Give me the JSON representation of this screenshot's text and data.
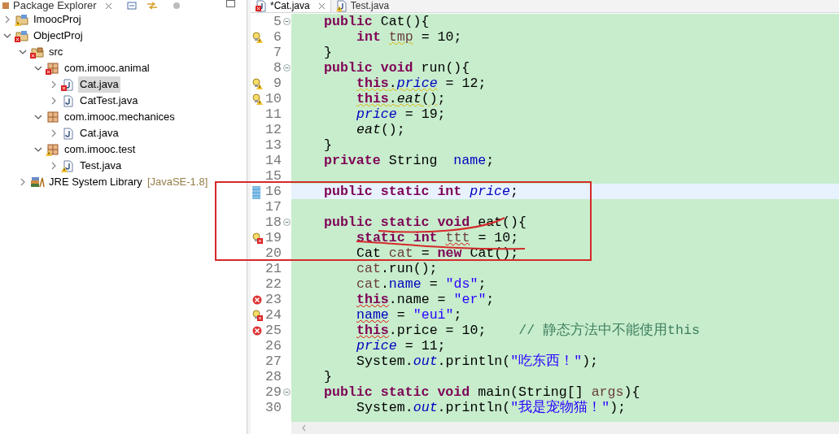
{
  "explorer": {
    "title": "Package Explorer",
    "tree": [
      {
        "label": "ImoocProj",
        "kind": "project",
        "error": false,
        "warning": true,
        "expanded": false,
        "selected": false
      },
      {
        "label": "ObjectProj",
        "kind": "project",
        "error": true,
        "warning": false,
        "expanded": true,
        "selected": false,
        "children": [
          {
            "label": "src",
            "kind": "source-folder",
            "error": true,
            "warning": false,
            "expanded": true,
            "selected": false,
            "children": [
              {
                "label": "com.imooc.animal",
                "kind": "package",
                "error": true,
                "warning": false,
                "expanded": true,
                "selected": false,
                "children": [
                  {
                    "label": "Cat.java",
                    "kind": "java-file",
                    "error": true,
                    "warning": false,
                    "expanded": false,
                    "selected": true
                  },
                  {
                    "label": "CatTest.java",
                    "kind": "java-file",
                    "error": false,
                    "warning": false,
                    "expanded": false,
                    "selected": false
                  }
                ]
              },
              {
                "label": "com.imooc.mechanices",
                "kind": "package",
                "error": false,
                "warning": false,
                "expanded": true,
                "selected": false,
                "children": [
                  {
                    "label": "Cat.java",
                    "kind": "java-file",
                    "error": false,
                    "warning": false,
                    "expanded": false,
                    "selected": false
                  }
                ]
              },
              {
                "label": "com.imooc.test",
                "kind": "package",
                "error": false,
                "warning": true,
                "expanded": true,
                "selected": false,
                "children": [
                  {
                    "label": "Test.java",
                    "kind": "java-file",
                    "error": false,
                    "warning": true,
                    "expanded": false,
                    "selected": false
                  }
                ]
              }
            ]
          },
          {
            "label": "JRE System Library",
            "suffix": "[JavaSE-1.8]",
            "kind": "library",
            "error": false,
            "warning": false,
            "expanded": false,
            "selected": false
          }
        ]
      }
    ]
  },
  "editor": {
    "tabs": [
      {
        "label": "*Cat.java",
        "error": true,
        "warning": false,
        "selected": true
      },
      {
        "label": "Test.java",
        "error": false,
        "warning": true,
        "selected": false
      }
    ],
    "lines": [
      {
        "number": "5",
        "kind": "member",
        "fold": true,
        "quickfix": false,
        "warning": false,
        "error": false,
        "highlighted": false,
        "tokens": [
          {
            "kind": "kw",
            "text": "public"
          },
          {
            "kind": "plain",
            "text": " Cat(){"
          }
        ]
      },
      {
        "number": "6",
        "kind": "statement",
        "fold": false,
        "quickfix": true,
        "warning": true,
        "error": false,
        "highlighted": false,
        "tokens": [
          {
            "kind": "kw",
            "text": "int "
          },
          {
            "kind": "warning-underline",
            "tokens": [
              {
                "kind": "local",
                "text": "tmp"
              }
            ]
          },
          {
            "kind": "plain",
            "text": " = 10;"
          }
        ]
      },
      {
        "number": "7",
        "kind": "member",
        "fold": false,
        "quickfix": false,
        "warning": false,
        "error": false,
        "highlighted": false,
        "tokens": [
          {
            "kind": "plain",
            "text": "}"
          }
        ]
      },
      {
        "number": "8",
        "kind": "member",
        "fold": true,
        "quickfix": false,
        "warning": false,
        "error": false,
        "highlighted": false,
        "tokens": [
          {
            "kind": "kw",
            "text": "public void"
          },
          {
            "kind": "plain",
            "text": " run(){"
          }
        ]
      },
      {
        "number": "9",
        "kind": "statement",
        "fold": false,
        "quickfix": true,
        "warning": true,
        "error": false,
        "highlighted": false,
        "tokens": [
          {
            "kind": "warning-underline",
            "tokens": [
              {
                "kind": "kw",
                "text": "this"
              },
              {
                "kind": "plain",
                "text": "."
              },
              {
                "kind": "static-field",
                "text": "price"
              }
            ]
          },
          {
            "kind": "plain",
            "text": " = 12;"
          }
        ]
      },
      {
        "number": "10",
        "kind": "statement",
        "fold": false,
        "quickfix": true,
        "warning": true,
        "error": false,
        "highlighted": false,
        "tokens": [
          {
            "kind": "warning-underline",
            "tokens": [
              {
                "kind": "kw",
                "text": "this"
              },
              {
                "kind": "plain",
                "text": "."
              },
              {
                "kind": "static-method",
                "text": "eat"
              },
              {
                "kind": "plain",
                "text": "()"
              }
            ]
          },
          {
            "kind": "plain",
            "text": ";"
          }
        ]
      },
      {
        "number": "11",
        "kind": "statement",
        "fold": false,
        "quickfix": false,
        "warning": false,
        "error": false,
        "highlighted": false,
        "tokens": [
          {
            "kind": "static-field",
            "text": "price"
          },
          {
            "kind": "plain",
            "text": " = 19;"
          }
        ]
      },
      {
        "number": "12",
        "kind": "statement",
        "fold": false,
        "quickfix": false,
        "warning": false,
        "error": false,
        "highlighted": false,
        "tokens": [
          {
            "kind": "static-method",
            "text": "eat"
          },
          {
            "kind": "plain",
            "text": "();"
          }
        ]
      },
      {
        "number": "13",
        "kind": "member",
        "fold": false,
        "quickfix": false,
        "warning": false,
        "error": false,
        "highlighted": false,
        "tokens": [
          {
            "kind": "plain",
            "text": "}"
          }
        ]
      },
      {
        "number": "14",
        "kind": "member",
        "fold": false,
        "quickfix": false,
        "warning": false,
        "error": false,
        "highlighted": false,
        "tokens": [
          {
            "kind": "kw",
            "text": "private"
          },
          {
            "kind": "plain",
            "text": " String  "
          },
          {
            "kind": "field",
            "text": "name"
          },
          {
            "kind": "plain",
            "text": ";"
          }
        ]
      },
      {
        "number": "15",
        "kind": "blank",
        "fold": false,
        "quickfix": false,
        "warning": false,
        "error": false,
        "highlighted": false
      },
      {
        "number": "16",
        "kind": "member",
        "fold": false,
        "quickfix": false,
        "warning": false,
        "error": false,
        "highlighted": true,
        "tokens": [
          {
            "kind": "kw",
            "text": "public static int "
          },
          {
            "kind": "static-field",
            "text": "price"
          },
          {
            "kind": "plain",
            "text": ";"
          }
        ]
      },
      {
        "number": "17",
        "kind": "blank",
        "fold": false,
        "quickfix": false,
        "warning": false,
        "error": false,
        "highlighted": false
      },
      {
        "number": "18",
        "kind": "member",
        "fold": true,
        "quickfix": false,
        "warning": false,
        "error": false,
        "highlighted": false,
        "tokens": [
          {
            "kind": "kw",
            "text": "public static void"
          },
          {
            "kind": "plain",
            "text": " eat(){"
          }
        ]
      },
      {
        "number": "19",
        "kind": "statement",
        "fold": false,
        "quickfix": true,
        "warning": false,
        "error": true,
        "highlighted": false,
        "tokens": [
          {
            "kind": "kw",
            "text": "static int "
          },
          {
            "kind": "error-underline",
            "tokens": [
              {
                "kind": "local",
                "text": "ttt"
              }
            ]
          },
          {
            "kind": "plain",
            "text": " = 10;"
          }
        ]
      },
      {
        "number": "20",
        "kind": "statement",
        "fold": false,
        "quickfix": false,
        "warning": false,
        "error": false,
        "highlighted": false,
        "tokens": [
          {
            "kind": "plain",
            "text": "Cat "
          },
          {
            "kind": "local",
            "text": "cat"
          },
          {
            "kind": "plain",
            "text": " = "
          },
          {
            "kind": "kw",
            "text": "new"
          },
          {
            "kind": "plain",
            "text": " Cat();"
          }
        ]
      },
      {
        "number": "21",
        "kind": "statement",
        "fold": false,
        "quickfix": false,
        "warning": false,
        "error": false,
        "highlighted": false,
        "tokens": [
          {
            "kind": "local",
            "text": "cat"
          },
          {
            "kind": "plain",
            "text": ".run();"
          }
        ]
      },
      {
        "number": "22",
        "kind": "statement",
        "fold": false,
        "quickfix": false,
        "warning": false,
        "error": false,
        "highlighted": false,
        "tokens": [
          {
            "kind": "local",
            "text": "cat"
          },
          {
            "kind": "plain",
            "text": "."
          },
          {
            "kind": "field",
            "text": "name"
          },
          {
            "kind": "plain",
            "text": " = "
          },
          {
            "kind": "string",
            "text": "\"ds\""
          },
          {
            "kind": "plain",
            "text": ";"
          }
        ]
      },
      {
        "number": "23",
        "kind": "statement",
        "fold": false,
        "quickfix": false,
        "warning": false,
        "error": true,
        "highlighted": false,
        "tokens": [
          {
            "kind": "error-underline",
            "tokens": [
              {
                "kind": "kw",
                "text": "this"
              }
            ]
          },
          {
            "kind": "plain",
            "text": ".name = "
          },
          {
            "kind": "string",
            "text": "\"er\""
          },
          {
            "kind": "plain",
            "text": ";"
          }
        ]
      },
      {
        "number": "24",
        "kind": "statement",
        "fold": false,
        "quickfix": true,
        "warning": false,
        "error": true,
        "highlighted": false,
        "tokens": [
          {
            "kind": "error-underline",
            "tokens": [
              {
                "kind": "field",
                "text": "name"
              }
            ]
          },
          {
            "kind": "plain",
            "text": " = "
          },
          {
            "kind": "string",
            "text": "\"eui\""
          },
          {
            "kind": "plain",
            "text": ";"
          }
        ]
      },
      {
        "number": "25",
        "kind": "statement",
        "fold": false,
        "quickfix": false,
        "warning": false,
        "error": true,
        "highlighted": false,
        "tokens": [
          {
            "kind": "error-underline",
            "tokens": [
              {
                "kind": "kw",
                "text": "this"
              }
            ]
          },
          {
            "kind": "plain",
            "text": ".price = 10;    "
          },
          {
            "kind": "comment",
            "text": "// 静态方法中不能使用this"
          }
        ]
      },
      {
        "number": "26",
        "kind": "statement",
        "fold": false,
        "quickfix": false,
        "warning": false,
        "error": false,
        "highlighted": false,
        "tokens": [
          {
            "kind": "static-field",
            "text": "price"
          },
          {
            "kind": "plain",
            "text": " = 11;"
          }
        ]
      },
      {
        "number": "27",
        "kind": "statement",
        "fold": false,
        "quickfix": false,
        "warning": false,
        "error": false,
        "highlighted": false,
        "tokens": [
          {
            "kind": "plain",
            "text": "System."
          },
          {
            "kind": "static-field",
            "text": "out"
          },
          {
            "kind": "plain",
            "text": ".println("
          },
          {
            "kind": "string",
            "text": "\"吃东西！\""
          },
          {
            "kind": "plain",
            "text": ");"
          }
        ]
      },
      {
        "number": "28",
        "kind": "member",
        "fold": false,
        "quickfix": false,
        "warning": false,
        "error": false,
        "highlighted": false,
        "tokens": [
          {
            "kind": "plain",
            "text": "}"
          }
        ]
      },
      {
        "number": "29",
        "kind": "member",
        "fold": true,
        "quickfix": false,
        "warning": false,
        "error": false,
        "highlighted": false,
        "tokens": [
          {
            "kind": "kw",
            "text": "public static void"
          },
          {
            "kind": "plain",
            "text": " main(String[] "
          },
          {
            "kind": "local",
            "text": "args"
          },
          {
            "kind": "plain",
            "text": "){"
          }
        ]
      },
      {
        "number": "30",
        "kind": "statement",
        "fold": false,
        "quickfix": false,
        "warning": false,
        "error": false,
        "highlighted": false,
        "tokens": [
          {
            "kind": "plain",
            "text": "System."
          },
          {
            "kind": "static-field",
            "text": "out"
          },
          {
            "kind": "plain",
            "text": ".println("
          },
          {
            "kind": "string",
            "text": "\"我是宠物猫！\""
          },
          {
            "kind": "plain",
            "text": ");"
          }
        ]
      }
    ]
  }
}
